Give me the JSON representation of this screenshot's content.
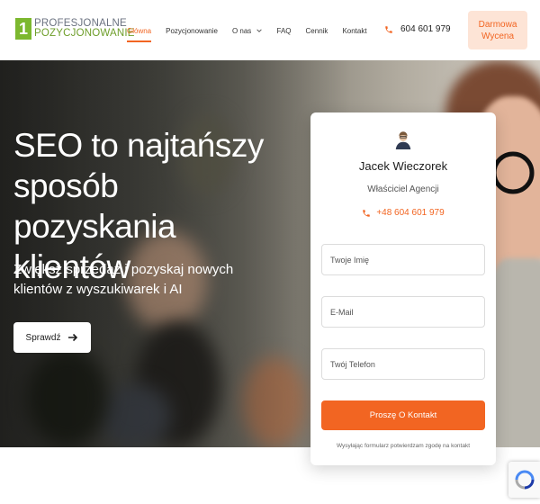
{
  "brand": {
    "logo_number": "1",
    "line1": "PROFESJONALNE",
    "line2": "POZYCJONOWANIE"
  },
  "nav": {
    "items": [
      "Główna",
      "Pozycjonowanie",
      "O nas",
      "FAQ",
      "Cennik",
      "Kontakt"
    ],
    "active": "Główna"
  },
  "header": {
    "phone": "604 601 979",
    "cta_line1": "Darmowa",
    "cta_line2": "Wycena"
  },
  "hero": {
    "title": "SEO to najtańszy sposób pozyskania klientów",
    "subtitle": "Zwiększ sprzedaż i pozyskaj nowych klientów z wyszukiwarek i AI",
    "button_label": "Sprawdź"
  },
  "form": {
    "agent_name": "Jacek Wieczorek",
    "agent_role": "Właściciel Agencji",
    "agent_phone": "+48 604 601 979",
    "name_placeholder": "Twoje Imię",
    "email_placeholder": "E-Mail",
    "phone_placeholder": "Twój Telefon",
    "submit_label": "Proszę O Kontakt",
    "consent": "Wysyłając formularz potwierdzam zgodę na kontakt"
  },
  "colors": {
    "accent": "#f26522",
    "logo_green": "#7cb82f",
    "cta_bg": "#fde4d6"
  },
  "icons": {
    "phone": "phone-icon",
    "arrow": "arrow-right-icon",
    "chevron": "chevron-down-icon",
    "avatar": "avatar-icon",
    "recaptcha": "recaptcha-icon"
  }
}
